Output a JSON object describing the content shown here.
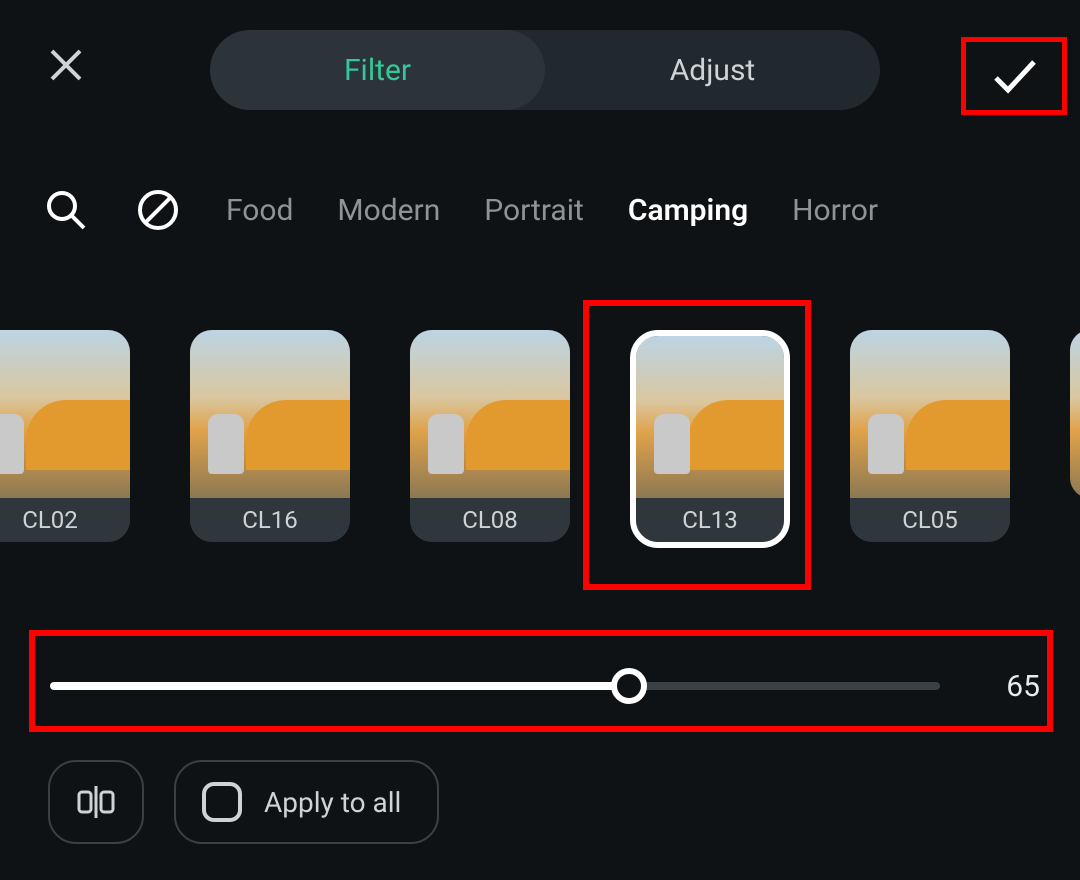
{
  "header": {
    "tabs": [
      {
        "label": "Filter",
        "active": true
      },
      {
        "label": "Adjust",
        "active": false
      }
    ]
  },
  "categories": {
    "items": [
      {
        "label": "Food",
        "active": false
      },
      {
        "label": "Modern",
        "active": false
      },
      {
        "label": "Portrait",
        "active": false
      },
      {
        "label": "Camping",
        "active": true
      },
      {
        "label": "Horror",
        "active": false
      }
    ]
  },
  "filters": {
    "items": [
      {
        "label": "CL02",
        "selected": false
      },
      {
        "label": "CL16",
        "selected": false
      },
      {
        "label": "CL08",
        "selected": false
      },
      {
        "label": "CL13",
        "selected": true
      },
      {
        "label": "CL05",
        "selected": false
      }
    ]
  },
  "slider": {
    "value": 65,
    "display": "65",
    "min": 0,
    "max": 100
  },
  "actions": {
    "apply_all_label": "Apply to all"
  },
  "highlights": {
    "confirm_button": true,
    "selected_filter": true,
    "slider": true
  },
  "icons": {
    "close": "close-icon",
    "confirm": "check-icon",
    "search": "search-icon",
    "none_filter": "no-filter-icon",
    "compare": "compare-icon",
    "apply_checkbox": "checkbox-icon"
  },
  "colors": {
    "bg": "#0f1214",
    "accent": "#34c79a",
    "highlight": "#ff0000",
    "text_muted": "#8d9397"
  }
}
